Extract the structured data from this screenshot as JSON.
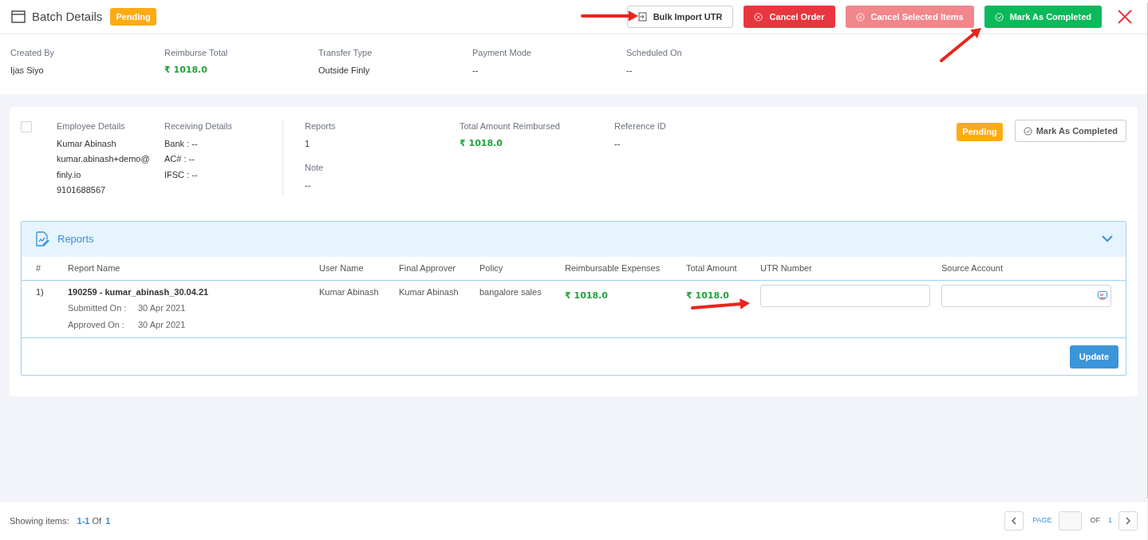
{
  "header": {
    "title": "Batch Details",
    "status": "Pending",
    "buttons": [
      {
        "label": "Bulk Import UTR",
        "kind": "outline",
        "disabled": false
      },
      {
        "label": "Cancel Order",
        "kind": "danger",
        "disabled": false
      },
      {
        "label": "Cancel Selected Items",
        "kind": "danger",
        "disabled": true
      },
      {
        "label": "Mark As Completed",
        "kind": "success",
        "disabled": false
      }
    ]
  },
  "summary": [
    {
      "label": "Created By",
      "value": "Ijas Siyo",
      "kind": "text"
    },
    {
      "label": "Reimburse Total",
      "value": "₹ 1018.0",
      "kind": "amount"
    },
    {
      "label": "Transfer Type",
      "value": "Outside Finly",
      "kind": "text"
    },
    {
      "label": "Payment Mode",
      "value": "--",
      "kind": "text"
    },
    {
      "label": "Scheduled On",
      "value": "--",
      "kind": "text"
    }
  ],
  "batch_item": {
    "checked": false,
    "employee": {
      "label": "Employee Details",
      "lines": [
        "Kumar Abinash",
        "kumar.abinash+demo@",
        "finly.io",
        "9101688567"
      ]
    },
    "receiving": {
      "label": "Receiving Details",
      "lines": [
        "Bank : --",
        "AC# : --",
        "IFSC : --"
      ]
    },
    "fields": [
      {
        "label": "Reports",
        "value": "1",
        "kind": "text"
      },
      {
        "label": "Total Amount Reimbursed",
        "value": "₹ 1018.0",
        "kind": "amount"
      },
      {
        "label": "Reference ID",
        "value": "--",
        "kind": "text"
      }
    ],
    "note": {
      "label": "Note",
      "value": "--"
    },
    "status": "Pending",
    "action": "Mark As Completed"
  },
  "reports": {
    "title": "Reports",
    "expanded": true,
    "columns": [
      "#",
      "Report Name",
      "User Name",
      "Final Approver",
      "Policy",
      "Reimbursable Expenses",
      "Total Amount",
      "UTR Number",
      "Source Account"
    ],
    "rows": [
      {
        "index": "1)",
        "report_name": "190259 - kumar_abinash_30.04.21",
        "submitted_label": "Submitted On :",
        "submitted": "30 Apr 2021",
        "approved_label": "Approved On :",
        "approved": "30 Apr 2021",
        "user_name": "Kumar Abinash",
        "final_approver": "Kumar Abinash",
        "policy": "bangalore sales",
        "reimbursable": "₹ 1018.0",
        "total": "₹ 1018.0"
      }
    ],
    "update": "Update"
  },
  "footer": {
    "showing": "Showing items:",
    "range": "1-1",
    "of": "Of",
    "total": "1",
    "page_label": "PAGE",
    "page_of": "OF",
    "pages": "1"
  }
}
